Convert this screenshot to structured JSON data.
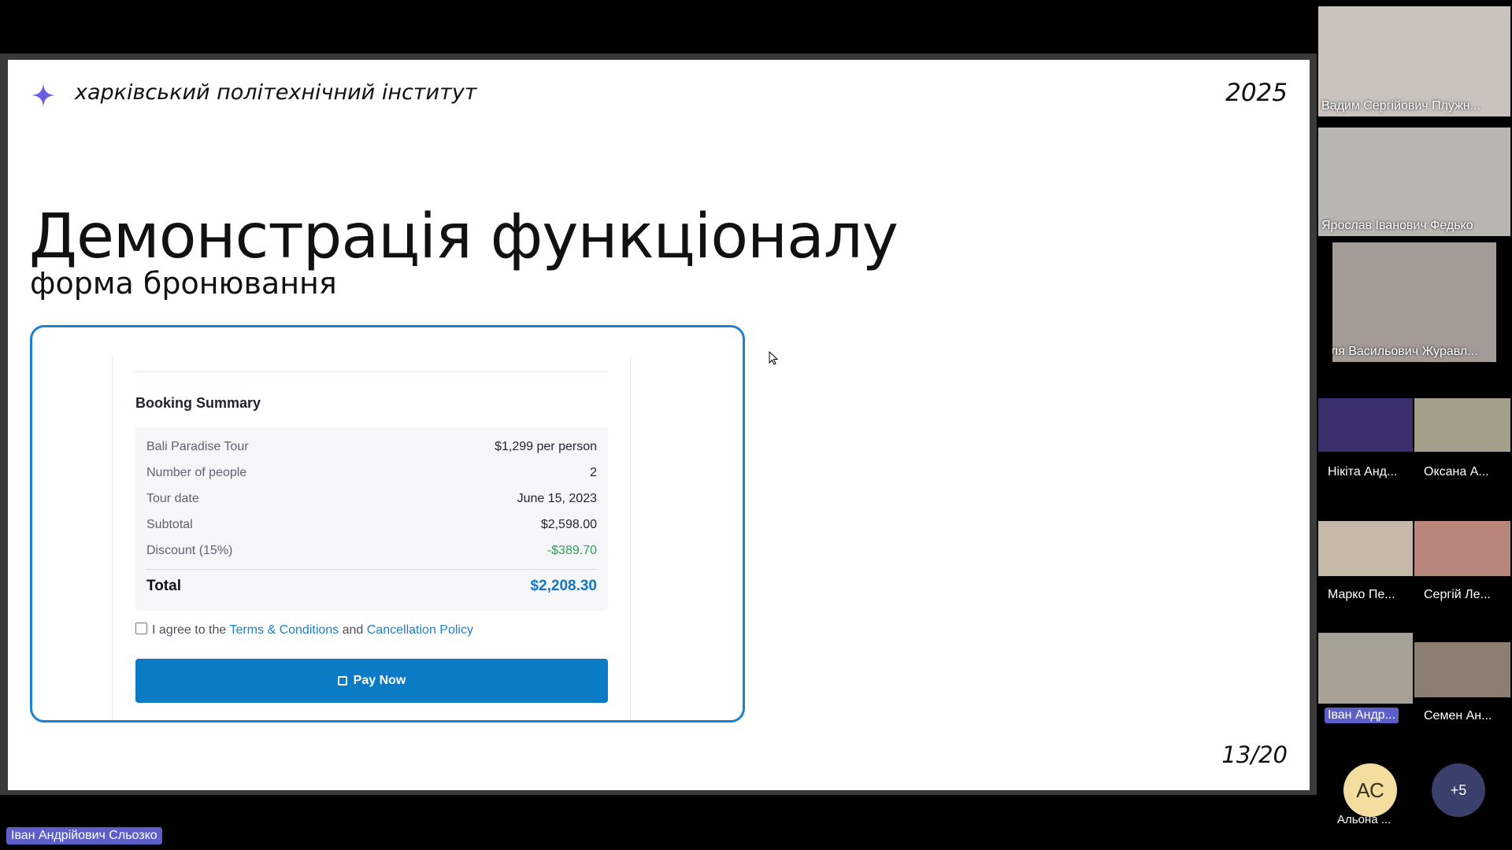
{
  "slide": {
    "brand": "харківський політехнічний інститут",
    "year": "2025",
    "title": "Демонстрація функціоналу",
    "subtitle": "форма бронювання",
    "page": "13/20"
  },
  "booking": {
    "heading": "Booking Summary",
    "rows": [
      {
        "label": "Bali Paradise Tour",
        "value": "$1,299 per person"
      },
      {
        "label": "Number of people",
        "value": "2"
      },
      {
        "label": "Tour date",
        "value": "June 15, 2023"
      },
      {
        "label": "Subtotal",
        "value": "$2,598.00"
      },
      {
        "label": "Discount (15%)",
        "value": "-$389.70"
      }
    ],
    "total_label": "Total",
    "total_value": "$2,208.30",
    "agree_prefix": "I agree to the",
    "terms_link": "Terms & Conditions",
    "agree_and": "and",
    "cancel_link": "Cancellation Policy",
    "pay_label": "Pay Now"
  },
  "participants": [
    {
      "name": "Вадим Сергійович Плужн..."
    },
    {
      "name": "Ярослав Іванович Федько"
    },
    {
      "name": "Ілля Васильович Журавл..."
    },
    {
      "name": "Нікіта Анд..."
    },
    {
      "name": "Оксана А..."
    },
    {
      "name": "Марко Пе..."
    },
    {
      "name": "Сергій Ле..."
    },
    {
      "name": "Іван Андр..."
    },
    {
      "name": "Семен Ан..."
    },
    {
      "name": "Альона ..."
    }
  ],
  "avatar_initials": "АС",
  "more_count": "+5",
  "speaker": "Іван Андрійович Сльозко",
  "colors": {
    "accent": "#1f7fd0",
    "pay_button": "#0b7bc6",
    "discount": "#2e9d55",
    "total": "#1577c2",
    "highlight_label": "#5b5fc7"
  }
}
